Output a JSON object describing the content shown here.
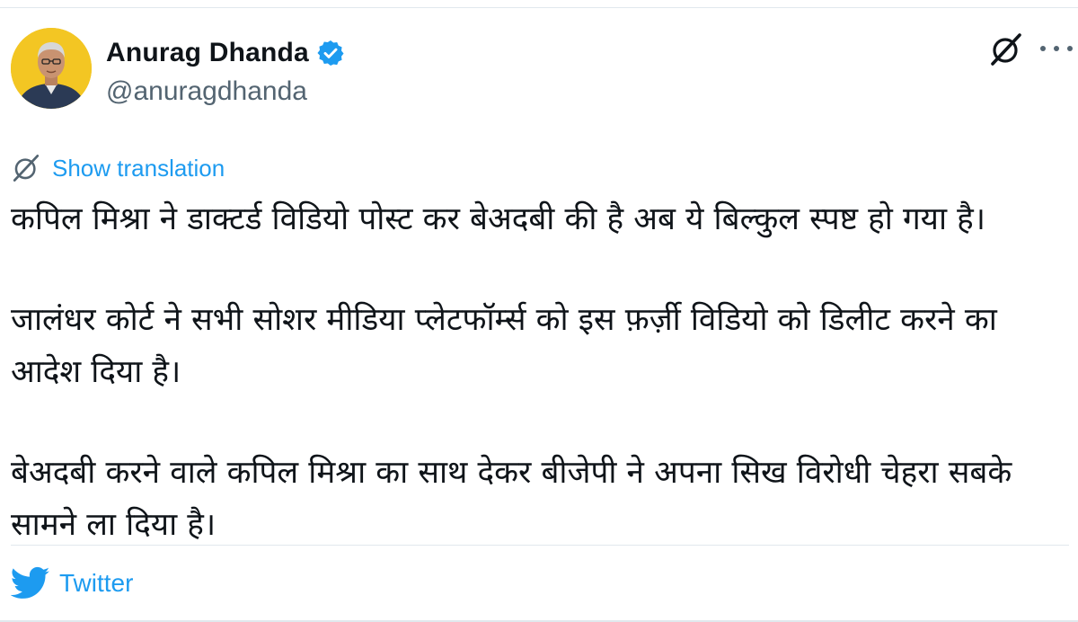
{
  "author": {
    "display_name": "Anurag Dhanda",
    "handle": "@anuragdhanda",
    "verified": true,
    "avatar_bg": "#f3c623"
  },
  "header": {
    "logo_icon": "x-logo-icon",
    "more_icon": "more-options-icon"
  },
  "translation": {
    "label": "Show translation",
    "icon": "translate-icon"
  },
  "tweet": {
    "paragraphs": [
      "कपिल मिश्रा ने डाक्टर्ड विडियो पोस्ट कर बेअदबी की है अब ये बिल्कुल स्पष्ट हो गया है।",
      "जालंधर कोर्ट ने सभी सोशर मीडिया प्लेटफॉर्म्स को इस फ़र्ज़ी विडियो को डिलीट करने का आदेश दिया है।",
      "बेअदबी करने वाले कपिल मिश्रा का साथ देकर बीजेपी ने अपना सिख विरोधी चेहरा सबके सामने ला दिया है।"
    ]
  },
  "footer": {
    "source_label": "Twitter",
    "icon": "twitter-bird-icon"
  },
  "colors": {
    "accent": "#1d9bf0",
    "text": "#0f1419",
    "muted": "#536471"
  }
}
